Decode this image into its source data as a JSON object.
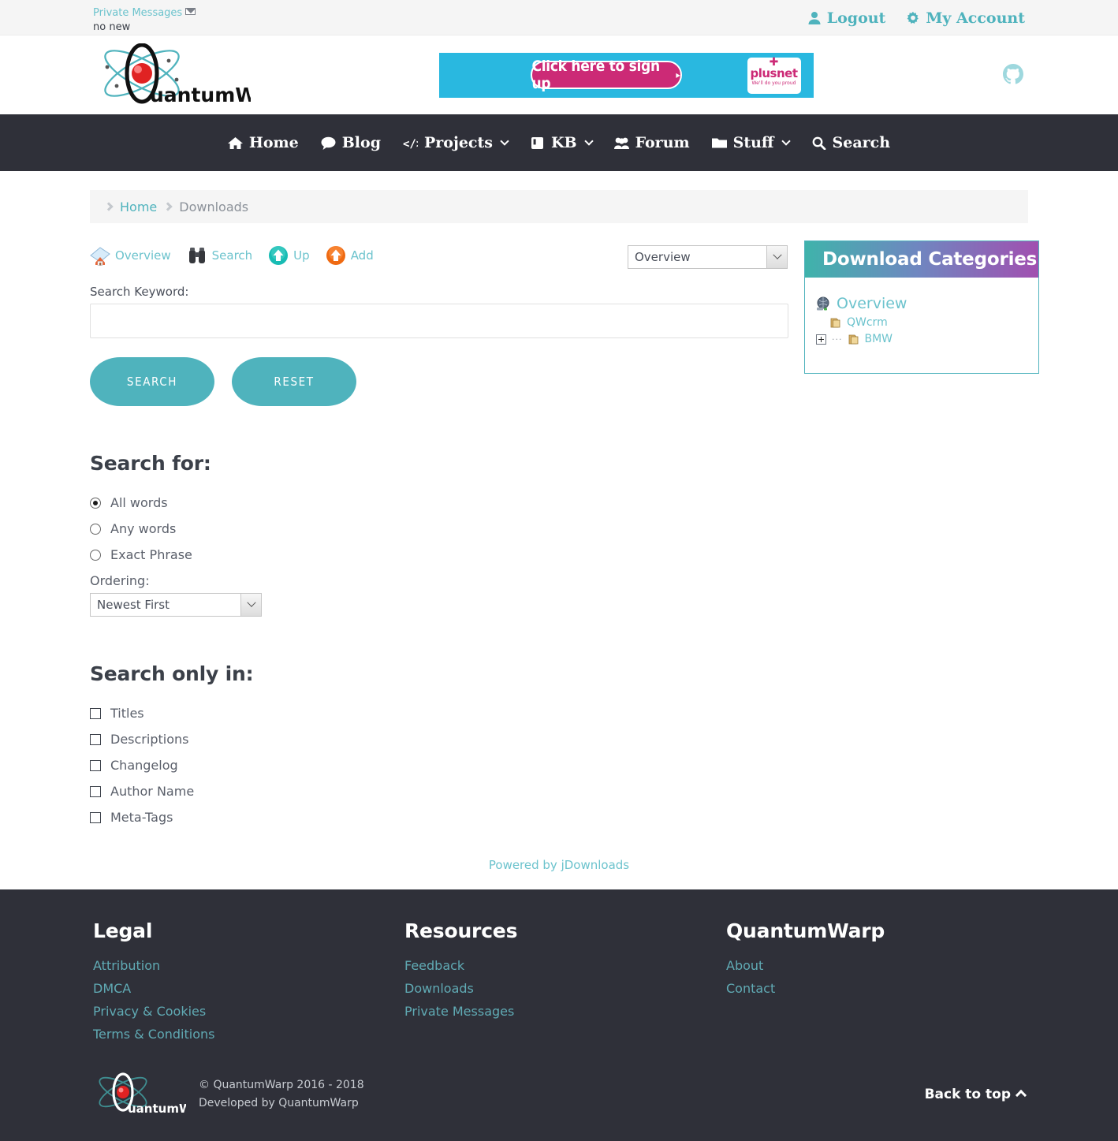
{
  "topbar": {
    "private_messages_label": "Private Messages",
    "private_messages_status": "no new",
    "logout_label": "Logout",
    "my_account_label": "My Account"
  },
  "header": {
    "site_name": "QuantumWarp",
    "banner": {
      "cta": "Click here to sign up",
      "cta_arrow": "▸",
      "brand_cross": "✚",
      "brand_name": "plusnet",
      "brand_tagline": "We'll do you proud"
    }
  },
  "nav": {
    "items": [
      {
        "label": "Home",
        "icon": "home-icon",
        "caret": false
      },
      {
        "label": "Blog",
        "icon": "comment-icon",
        "caret": false
      },
      {
        "label": "Projects",
        "icon": "code-icon",
        "caret": true
      },
      {
        "label": "KB",
        "icon": "book-icon",
        "caret": true
      },
      {
        "label": "Forum",
        "icon": "users-icon",
        "caret": false
      },
      {
        "label": "Stuff",
        "icon": "folder-icon",
        "caret": true
      },
      {
        "label": "Search",
        "icon": "search-icon",
        "caret": false
      }
    ]
  },
  "breadcrumb": {
    "home": "Home",
    "current": "Downloads"
  },
  "jdownloads_toolbar": {
    "items": [
      {
        "label": "Overview",
        "icon": "house-overview-icon"
      },
      {
        "label": "Search",
        "icon": "binoculars-icon"
      },
      {
        "label": "Up",
        "icon": "up-arrow-teal-icon"
      },
      {
        "label": "Add",
        "icon": "up-arrow-orange-icon"
      }
    ],
    "category_select_value": "Overview"
  },
  "search_form": {
    "keyword_label": "Search Keyword:",
    "keyword_value": "",
    "keyword_placeholder": "",
    "search_button": "SEARCH",
    "reset_button": "RESET",
    "search_for_heading": "Search for:",
    "match_options": [
      {
        "label": "All words",
        "selected": true
      },
      {
        "label": "Any words",
        "selected": false
      },
      {
        "label": "Exact Phrase",
        "selected": false
      }
    ],
    "ordering_label": "Ordering:",
    "ordering_value": "Newest First",
    "search_only_in_heading": "Search only in:",
    "scope_options": [
      {
        "label": "Titles",
        "checked": false
      },
      {
        "label": "Descriptions",
        "checked": false
      },
      {
        "label": "Changelog",
        "checked": false
      },
      {
        "label": "Author Name",
        "checked": false
      },
      {
        "label": "Meta-Tags",
        "checked": false
      }
    ]
  },
  "powered_by": "Powered by jDownloads",
  "sidebar": {
    "module_title": "Download Categories",
    "tree": [
      {
        "label": "Overview",
        "icon": "globe-icon",
        "level": 0,
        "expandable": false
      },
      {
        "label": "QWcrm",
        "icon": "folder-icon",
        "level": 1,
        "expandable": false
      },
      {
        "label": "BMW",
        "icon": "folder-icon",
        "level": 1,
        "expandable": true
      }
    ]
  },
  "footer": {
    "columns": [
      {
        "title": "Legal",
        "links": [
          "Attribution",
          "DMCA",
          "Privacy & Cookies",
          "Terms & Conditions"
        ]
      },
      {
        "title": "Resources",
        "links": [
          "Feedback",
          "Downloads",
          "Private Messages"
        ]
      },
      {
        "title": "QuantumWarp",
        "links": [
          "About",
          "Contact"
        ]
      }
    ],
    "copyright": "© QuantumWarp 2016 - 2018",
    "developed_by": "Developed by QuantumWarp",
    "back_to_top": "Back to top"
  },
  "colors": {
    "accent_teal": "#4fb3bd",
    "link_teal": "#6cc3cd",
    "dark": "#2f3039",
    "module_gradient_start": "#3fb3ab",
    "module_gradient_end": "#a14fb0",
    "banner_bg": "#29b8e0",
    "banner_button": "#cc2a76"
  }
}
